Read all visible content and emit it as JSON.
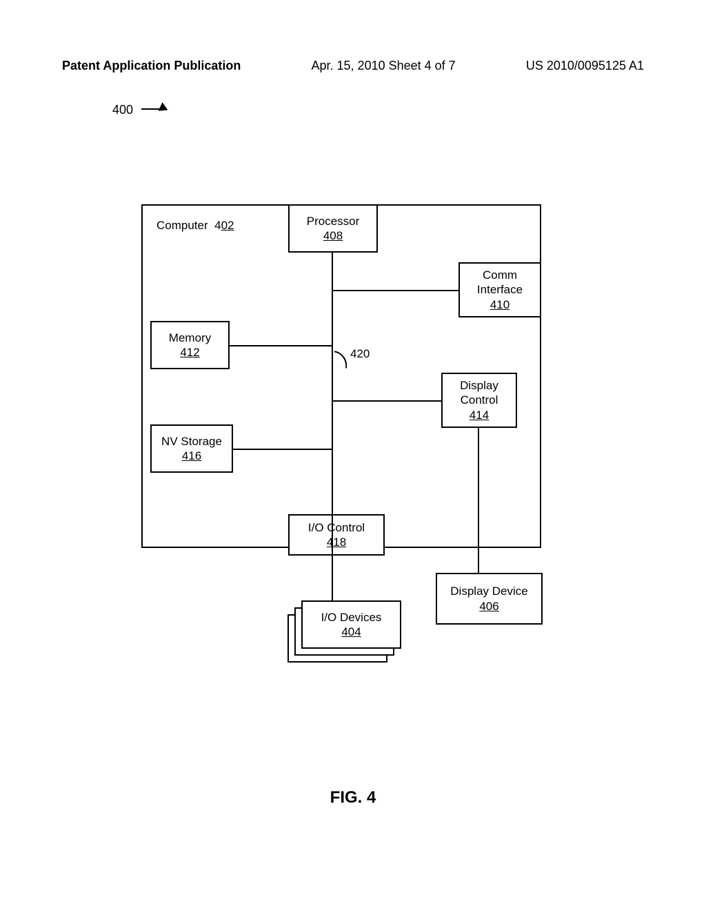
{
  "header": {
    "left": "Patent Application Publication",
    "center": "Apr. 15, 2010  Sheet 4 of 7",
    "right": "US 2010/0095125 A1"
  },
  "figure": {
    "ref_label": "400",
    "caption": "FIG. 4",
    "bus_ref": "420"
  },
  "blocks": {
    "computer": {
      "name": "Computer",
      "ref_prefix": "4",
      "ref_suffix": "02"
    },
    "processor": {
      "name": "Processor",
      "ref": "408"
    },
    "comm": {
      "name": "Comm\nInterface",
      "ref": "410"
    },
    "memory": {
      "name": "Memory",
      "ref": "412"
    },
    "display_ctrl": {
      "name": "Display\nControl",
      "ref": "414"
    },
    "nv_storage": {
      "name": "NV Storage",
      "ref": "416"
    },
    "io_ctrl": {
      "name": "I/O Control",
      "ref": "418"
    },
    "io_devices": {
      "name": "I/O Devices",
      "ref": "404"
    },
    "display_dev": {
      "name": "Display Device",
      "ref": "406"
    }
  }
}
